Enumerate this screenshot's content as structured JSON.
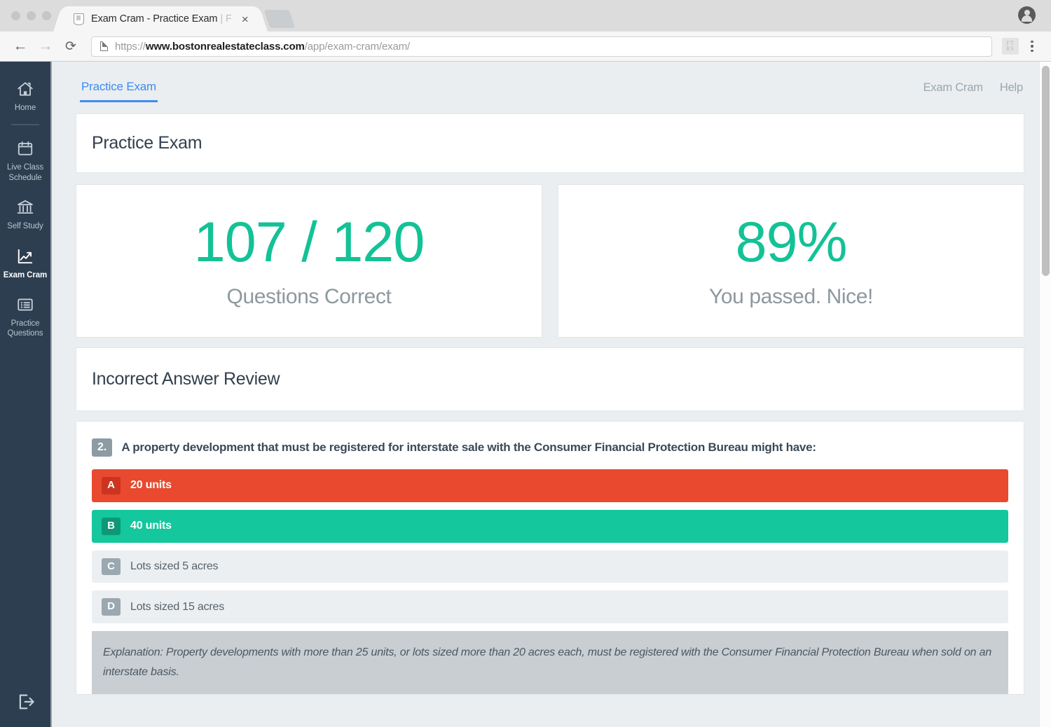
{
  "browser": {
    "tab": {
      "title_main": "Exam Cram - Practice Exam",
      "title_fade": " | F",
      "close_label": "×",
      "favicon_name": "shield-favicon"
    },
    "toolbar": {
      "back_label": "←",
      "forward_label": "→",
      "reload_label": "⟳",
      "url_scheme": "https://",
      "url_host": "www.bostonrealestateclass.com",
      "url_path": "/app/exam-cram/exam/",
      "extension_label": "FT RS"
    }
  },
  "sidebar": {
    "items": [
      {
        "label": "Home",
        "icon": "home-icon",
        "active": false
      },
      {
        "label": "Live Class Schedule",
        "icon": "calendar-icon",
        "active": false
      },
      {
        "label": "Self Study",
        "icon": "bank-icon",
        "active": false
      },
      {
        "label": "Exam Cram",
        "icon": "chart-up-icon",
        "active": true
      },
      {
        "label": "Practice Questions",
        "icon": "list-icon",
        "active": false
      }
    ],
    "logout_icon": "logout-icon"
  },
  "header": {
    "active_tab": "Practice Exam",
    "links": [
      "Exam Cram",
      "Help"
    ]
  },
  "main": {
    "page_title": "Practice Exam",
    "stats": [
      {
        "value": "107 / 120",
        "label": "Questions Correct"
      },
      {
        "value": "89%",
        "label": "You passed. Nice!"
      }
    ],
    "review_title": "Incorrect Answer Review",
    "question": {
      "number": "2.",
      "text": "A property development that must be registered for interstate sale with the Consumer Financial Protection Bureau might have:",
      "options": [
        {
          "letter": "A",
          "text": "20 units",
          "state": "wrong"
        },
        {
          "letter": "B",
          "text": "40 units",
          "state": "right"
        },
        {
          "letter": "C",
          "text": "Lots sized 5 acres",
          "state": "plain"
        },
        {
          "letter": "D",
          "text": "Lots sized 15 acres",
          "state": "plain"
        }
      ],
      "explanation": "Explanation: Property developments with more than 25 units, or lots sized more than 20 acres each, must be registered with the Consumer Financial Protection Bureau when sold on an interstate basis."
    }
  },
  "colors": {
    "accent_green": "#13c296",
    "accent_blue": "#3d8bf2",
    "wrong_red": "#e8492f",
    "sidebar_bg": "#2d3e50",
    "page_bg": "#eaeef0"
  }
}
